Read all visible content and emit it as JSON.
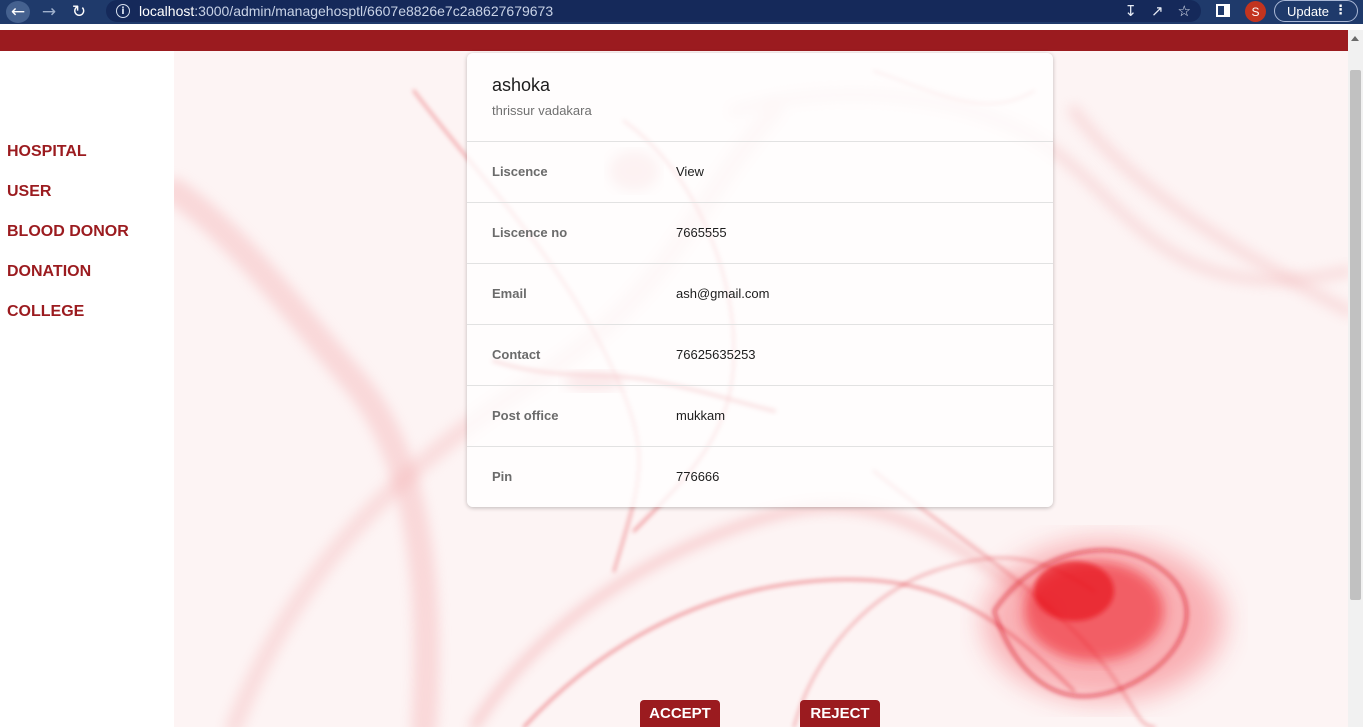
{
  "browser": {
    "url_host": "localhost",
    "url_path": ":3000/admin/managehosptl/6607e8826e7c2a8627679673",
    "profile_initial": "S",
    "update_label": "Update"
  },
  "sidebar": {
    "items": [
      {
        "label": "HOSPITAL"
      },
      {
        "label": "USER"
      },
      {
        "label": "BLOOD DONOR"
      },
      {
        "label": "DONATION"
      },
      {
        "label": "COLLEGE"
      }
    ]
  },
  "hospital": {
    "name": "ashoka",
    "address": "thrissur vadakara",
    "fields": [
      {
        "label": "Liscence",
        "value": "View"
      },
      {
        "label": "Liscence no",
        "value": "7665555"
      },
      {
        "label": "Email",
        "value": "ash@gmail.com"
      },
      {
        "label": "Contact",
        "value": "76625635253"
      },
      {
        "label": "Post office",
        "value": "mukkam"
      },
      {
        "label": "Pin",
        "value": "776666"
      }
    ]
  },
  "actions": {
    "accept_label": "ACCEPT",
    "reject_label": "REJECT"
  },
  "theme": {
    "accent": "#9b1b1f",
    "chrome": "#1f3a6b"
  }
}
